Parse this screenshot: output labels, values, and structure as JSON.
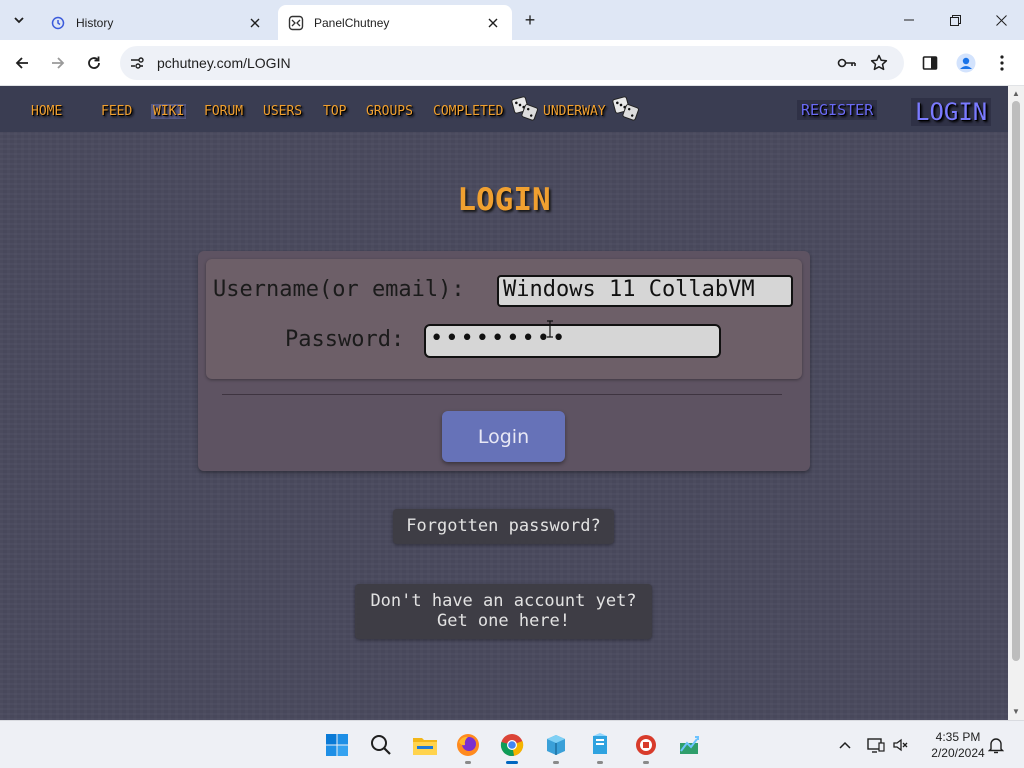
{
  "browser": {
    "tabs": [
      {
        "title": "History",
        "icon": "history-icon",
        "active": false
      },
      {
        "title": "PanelChutney",
        "icon": "panelchutney-favicon",
        "active": true
      }
    ],
    "url": "pchutney.com/LOGIN",
    "new_tab_label": "+"
  },
  "site_nav": {
    "items": [
      "HOME",
      "FEED",
      "WIKI",
      "FORUM",
      "USERS",
      "TOP",
      "GROUPS",
      "COMPLETED",
      "UNDERWAY"
    ],
    "register": "REGISTER",
    "login": "LOGIN"
  },
  "login": {
    "title": "LOGIN",
    "username_label": "Username(or email):",
    "username_value": "Windows 11 CollabVM",
    "password_label": "Password:",
    "password_value": "•••••••••",
    "submit_label": "Login",
    "forgot_label": "Forgotten password?",
    "signup_line1": "Don't have an account yet?",
    "signup_line2": "Get one here!"
  },
  "taskbar": {
    "apps": [
      "start-icon",
      "search-icon",
      "file-explorer-icon",
      "firefox-icon",
      "chrome-icon",
      "app-icon-1",
      "app-icon-2",
      "app-icon-3",
      "app-icon-4"
    ],
    "time": "4:35 PM",
    "date": "2/20/2024"
  },
  "colors": {
    "page_bg": "#4a4a5e",
    "nav_text": "#f0a030",
    "title": "#f0a030",
    "login_link": "#7a7aff",
    "login_button": "#6672b8"
  }
}
